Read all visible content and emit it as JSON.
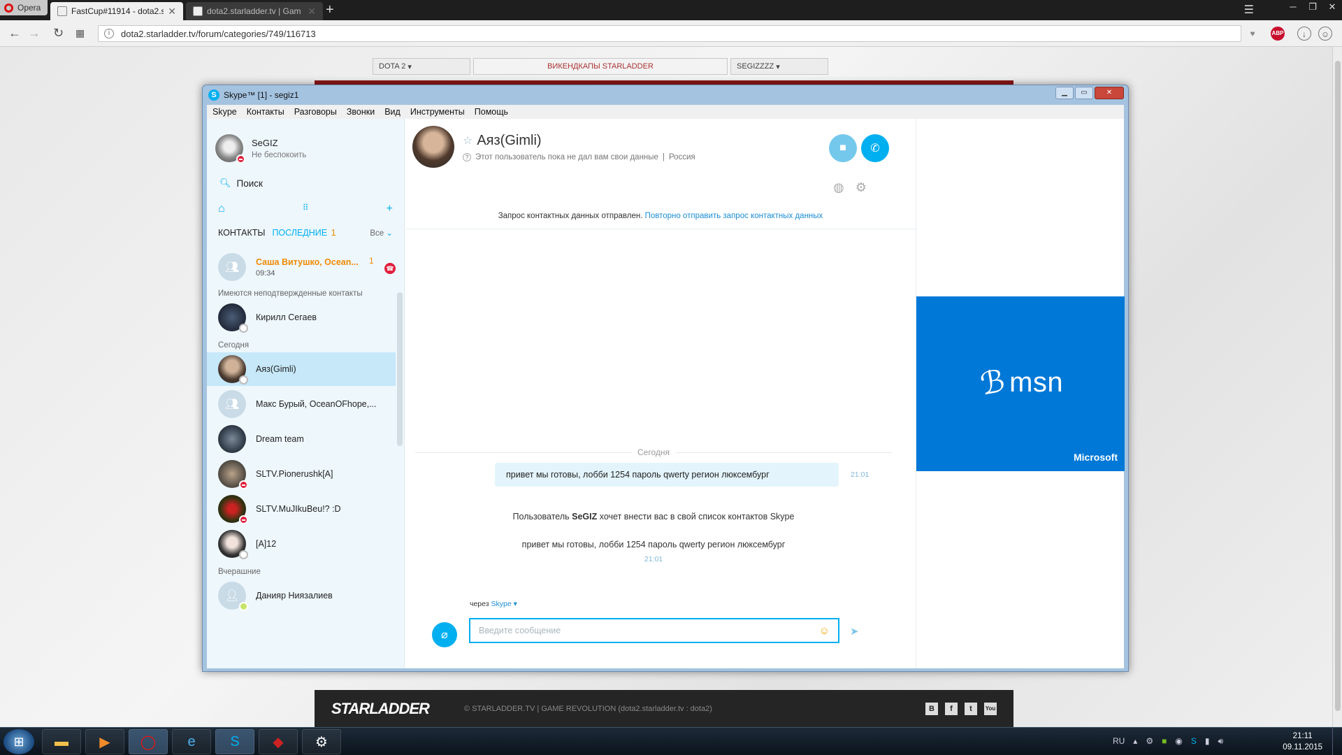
{
  "browser": {
    "brand": "Opera",
    "tabs": [
      {
        "title": "FastCup#11914 - dota2.sta",
        "active": true
      },
      {
        "title": "dota2.starladder.tv | Gam",
        "active": false
      }
    ],
    "url": "dota2.starladder.tv/forum/categories/749/116713",
    "adblock_badge": "ABP"
  },
  "site": {
    "topbar": {
      "left": "DOTA 2",
      "center": "ВИКЕНДКАПЫ STARLADDER",
      "right": "SEGIZZZZ"
    },
    "footer": {
      "logo_a": "STAR",
      "logo_b": "LADDER",
      "copyright": "© STARLADDER.TV | GAME REVOLUTION (dota2.starladder.tv : dota2)",
      "socials": [
        "B",
        "f",
        "t",
        "You"
      ]
    }
  },
  "skype": {
    "title": "Skype™ [1] - segiz1",
    "menu": [
      "Skype",
      "Контакты",
      "Разговоры",
      "Звонки",
      "Вид",
      "Инструменты",
      "Помощь"
    ],
    "profile": {
      "name": "SeGIZ",
      "status": "Не беспокоить"
    },
    "search_label": "Поиск",
    "lists": {
      "contacts": "КОНТАКТЫ",
      "recent": "ПОСЛЕДНИЕ",
      "recent_count": "1",
      "filter": "Все"
    },
    "unread_item": {
      "name": "Саша Витушко, Ocean...",
      "time": "09:34",
      "count": "1"
    },
    "section_pending": "Имеются неподтвержденные контакты",
    "pending_contact": "Кирилл Сегаев",
    "section_today": "Сегодня",
    "today_contacts": [
      "Аяз(Gimli)",
      "Макс Бурый, OceanOFhope,...",
      "Dream team",
      "SLTV.Pionerushk[A]",
      "SLTV.MuJIkuBeu!? :D",
      "[A]12"
    ],
    "section_yesterday": "Вчерашние",
    "yesterday_contacts": [
      "Данияр Ниязалиев"
    ],
    "conversation": {
      "name": "Аяз(Gimli)",
      "info": "Этот пользователь пока не дал вам свои данные",
      "country": "Россия",
      "notice": "Запрос контактных данных отправлен.",
      "notice_link": "Повторно отправить запрос контактных данных",
      "day": "Сегодня",
      "message": "привет мы готовы, лобби 1254 пароль qwerty регион люксембург",
      "message_time": "21:01",
      "sys_pre": "Пользователь",
      "sys_user": "SeGIZ",
      "sys_post": "хочет внести вас в свой список контактов Skype",
      "sys_message": "привет мы готовы, лобби 1254 пароль qwerty регион люксембург",
      "sys_time": "21:01",
      "via_label": "через",
      "via_service": "Skype",
      "input_placeholder": "Введите сообщение"
    },
    "ad": {
      "brand": "msn",
      "company": "Microsoft"
    }
  },
  "taskbar": {
    "language": "RU",
    "time": "21:11",
    "date": "09.11.2015"
  }
}
